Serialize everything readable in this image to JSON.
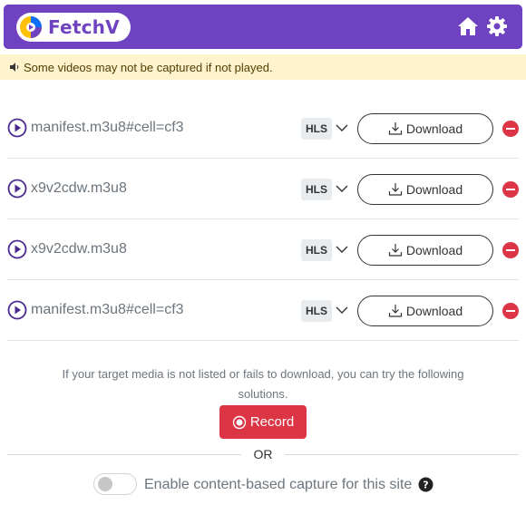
{
  "header": {
    "brand_name": "FetchV",
    "icons": {
      "logo": "fetchv-logo",
      "home": "home-icon",
      "settings": "gear-icon"
    },
    "colors": {
      "background": "#6f42c1"
    }
  },
  "alert": {
    "icon": "speaker-icon",
    "text": "Some videos may not be captured if not played.",
    "colors": {
      "background": "#fff3cd"
    }
  },
  "media_list": {
    "items": [
      {
        "filename": "manifest.m3u8#cell=cf3",
        "format": "HLS",
        "download_label": "Download"
      },
      {
        "filename": "x9v2cdw.m3u8",
        "format": "HLS",
        "download_label": "Download"
      },
      {
        "filename": "x9v2cdw.m3u8",
        "format": "HLS",
        "download_label": "Download"
      },
      {
        "filename": "manifest.m3u8#cell=cf3",
        "format": "HLS",
        "download_label": "Download"
      }
    ],
    "colors": {
      "play": "#6f42c1",
      "remove": "#dc3545"
    }
  },
  "footer": {
    "hint": "If your target media is not listed or fails to download, you can try the following solutions.",
    "record_label": "Record",
    "or_label": "OR",
    "capture_toggle_label": "Enable content-based capture for this site",
    "capture_enabled": false,
    "colors": {
      "record": "#dc3545"
    }
  }
}
